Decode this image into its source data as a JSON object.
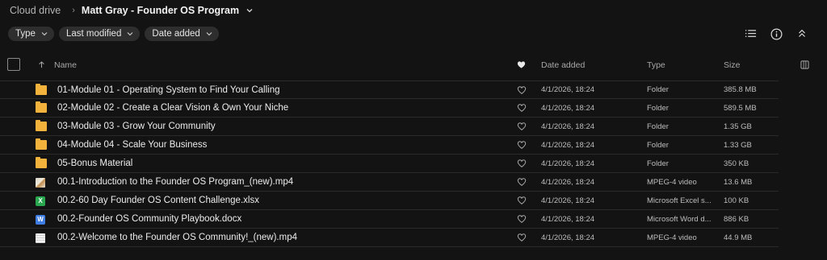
{
  "breadcrumb": {
    "root": "Cloud drive",
    "current": "Matt Gray - Founder OS Program"
  },
  "filters": [
    "Type",
    "Last modified",
    "Date added"
  ],
  "toolbar": {
    "icons": [
      "list-view-icon",
      "info-icon",
      "collapse-icon"
    ]
  },
  "columns": {
    "name": "Name",
    "date_added": "Date added",
    "type": "Type",
    "size": "Size"
  },
  "files": [
    {
      "name": "01-Module 01 - Operating System to Find Your Calling",
      "date": "4/1/2026, 18:24",
      "type": "Folder",
      "size": "385.8 MB",
      "icon": "folder"
    },
    {
      "name": "02-Module 02 - Create a Clear Vision & Own Your Niche",
      "date": "4/1/2026, 18:24",
      "type": "Folder",
      "size": "589.5 MB",
      "icon": "folder"
    },
    {
      "name": "03-Module 03 - Grow Your Community",
      "date": "4/1/2026, 18:24",
      "type": "Folder",
      "size": "1.35 GB",
      "icon": "folder"
    },
    {
      "name": "04-Module 04 - Scale Your Business",
      "date": "4/1/2026, 18:24",
      "type": "Folder",
      "size": "1.33 GB",
      "icon": "folder"
    },
    {
      "name": "05-Bonus Material",
      "date": "4/1/2026, 18:24",
      "type": "Folder",
      "size": "350 KB",
      "icon": "folder"
    },
    {
      "name": "00.1-Introduction to the Founder OS Program_(new).mp4",
      "date": "4/1/2026, 18:24",
      "type": "MPEG-4 video",
      "size": "13.6 MB",
      "icon": "video-thumb-a"
    },
    {
      "name": "00.2-60 Day Founder OS Content Challenge.xlsx",
      "date": "4/1/2026, 18:24",
      "type": "Microsoft Excel s...",
      "size": "100 KB",
      "icon": "excel",
      "badge": "X"
    },
    {
      "name": "00.2-Founder OS Community Playbook.docx",
      "date": "4/1/2026, 18:24",
      "type": "Microsoft Word d...",
      "size": "886 KB",
      "icon": "word",
      "badge": "W"
    },
    {
      "name": "00.2-Welcome to the Founder OS Community!_(new).mp4",
      "date": "4/1/2026, 18:24",
      "type": "MPEG-4 video",
      "size": "44.9 MB",
      "icon": "video-thumb-b"
    }
  ]
}
